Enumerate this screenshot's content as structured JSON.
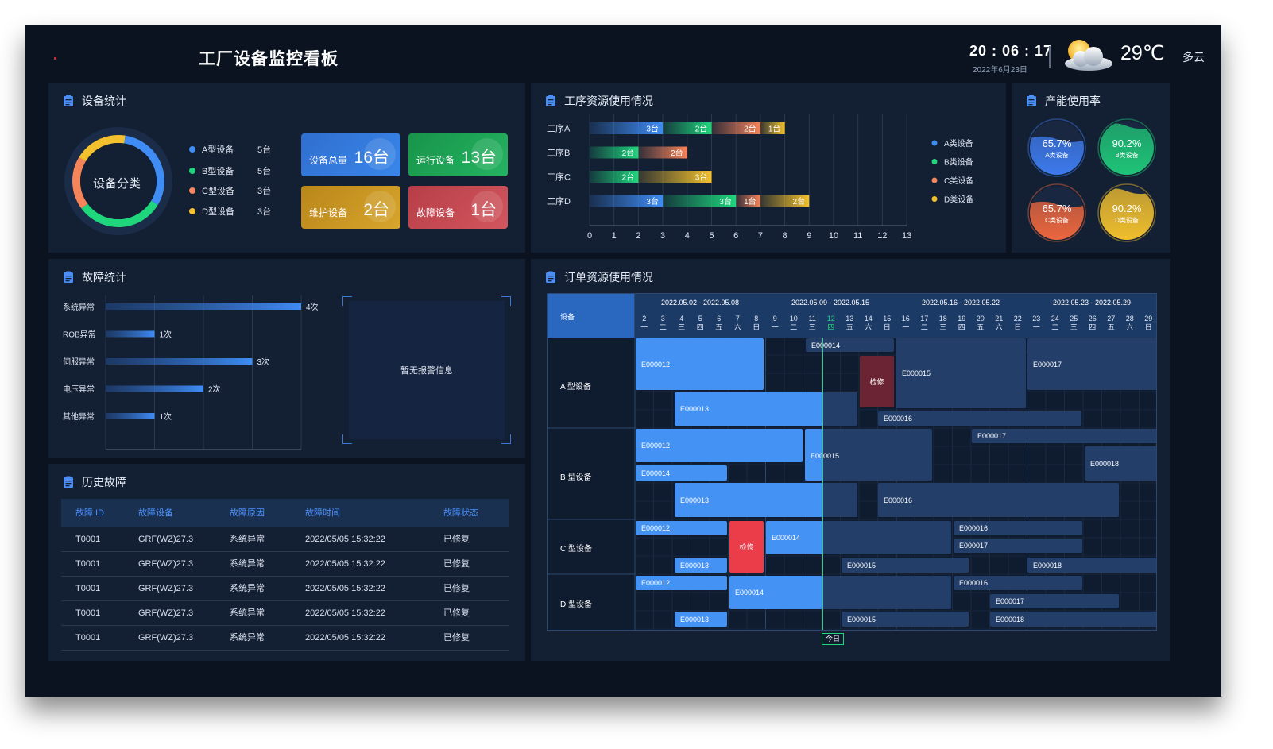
{
  "header": {
    "title": "工厂设备监控看板",
    "time": "20 : 06 : 17",
    "date": "2022年6月23日",
    "temperature": "29℃",
    "weather": "多云",
    "weather_icon": "partly-cloudy-icon"
  },
  "device_stats": {
    "title": "设备统计",
    "donut_label": "设备分类",
    "legend": [
      {
        "name": "A型设备",
        "count": "5台",
        "color": "#3e8cf4"
      },
      {
        "name": "B型设备",
        "count": "5台",
        "color": "#1fd67c"
      },
      {
        "name": "C型设备",
        "count": "3台",
        "color": "#f5845a"
      },
      {
        "name": "D型设备",
        "count": "3台",
        "color": "#f3c12d"
      }
    ],
    "cards": [
      {
        "label": "设备总量",
        "value": "16台",
        "color": "#3477d6"
      },
      {
        "label": "运行设备",
        "value": "13台",
        "color": "#1fa255"
      },
      {
        "label": "维护设备",
        "value": "2台",
        "color": "#c9961f"
      },
      {
        "label": "故障设备",
        "value": "1台",
        "color": "#c8474f"
      }
    ]
  },
  "process_resource": {
    "title": "工序资源使用情况",
    "type": "bar",
    "categories": [
      "工序A",
      "工序B",
      "工序C",
      "工序D"
    ],
    "x_ticks": [
      "0",
      "1",
      "2",
      "3",
      "4",
      "5",
      "6",
      "7",
      "8",
      "9",
      "10",
      "11",
      "12",
      "13"
    ],
    "xlim": [
      0,
      13
    ],
    "series": [
      {
        "name": "A类设备",
        "color": "#3e8cf4",
        "values": [
          3,
          0,
          0,
          3
        ],
        "labels": [
          "3台",
          "",
          "",
          "3台"
        ]
      },
      {
        "name": "B类设备",
        "color": "#1fd67c",
        "values": [
          2,
          2,
          2,
          3
        ],
        "labels": [
          "2台",
          "2台",
          "2台",
          "3台"
        ]
      },
      {
        "name": "C类设备",
        "color": "#f5845a",
        "values": [
          2,
          2,
          0,
          1
        ],
        "labels": [
          "2台",
          "2台",
          "",
          "1台"
        ]
      },
      {
        "name": "D类设备",
        "color": "#f3c12d",
        "values": [
          1,
          0,
          3,
          2
        ],
        "labels": [
          "1台",
          "",
          "3台",
          "2台"
        ]
      }
    ]
  },
  "capacity": {
    "title": "产能使用率",
    "items": [
      {
        "value": "65.7%",
        "label": "A类设备",
        "fraction": 0.657,
        "color": "#3e7cf0"
      },
      {
        "value": "90.2%",
        "label": "B类设备",
        "fraction": 0.902,
        "color": "#1fc678"
      },
      {
        "value": "65.7%",
        "label": "C类设备",
        "fraction": 0.657,
        "color": "#f0683e"
      },
      {
        "value": "90.2%",
        "label": "D类设备",
        "fraction": 0.902,
        "color": "#f3c12d"
      }
    ]
  },
  "fault_stats": {
    "title": "故障统计",
    "type": "bar",
    "categories": [
      "系统异常",
      "ROB异常",
      "伺服异常",
      "电压异常",
      "其他异常"
    ],
    "values": [
      4,
      1,
      3,
      2,
      1
    ],
    "value_labels": [
      "4次",
      "1次",
      "3次",
      "2次",
      "1次"
    ],
    "x_ticks": [
      "0",
      "1",
      "2",
      "3",
      "4"
    ],
    "xlim": [
      0,
      4
    ],
    "alarm_text": "暂无报警信息"
  },
  "history": {
    "title": "历史故障",
    "columns": [
      "故障 ID",
      "故障设备",
      "故障原因",
      "故障时间",
      "故障状态"
    ],
    "rows": [
      [
        "T0001",
        "GRF(WZ)27.3",
        "系统异常",
        "2022/05/05 15:32:22",
        "已修复"
      ],
      [
        "T0001",
        "GRF(WZ)27.3",
        "系统异常",
        "2022/05/05 15:32:22",
        "已修复"
      ],
      [
        "T0001",
        "GRF(WZ)27.3",
        "系统异常",
        "2022/05/05 15:32:22",
        "已修复"
      ],
      [
        "T0001",
        "GRF(WZ)27.3",
        "系统异常",
        "2022/05/05 15:32:22",
        "已修复"
      ],
      [
        "T0001",
        "GRF(WZ)27.3",
        "系统异常",
        "2022/05/05 15:32:22",
        "已修复"
      ]
    ]
  },
  "orders": {
    "title": "订单资源使用情况",
    "device_header": "设备",
    "weeks": [
      "2022.05.02 - 2022.05.08",
      "2022.05.09 - 2022.05.15",
      "2022.05.16 - 2022.05.22",
      "2022.05.23 - 2022.05.29"
    ],
    "days": [
      {
        "d": "2",
        "w": "一"
      },
      {
        "d": "3",
        "w": "二"
      },
      {
        "d": "4",
        "w": "三"
      },
      {
        "d": "5",
        "w": "四"
      },
      {
        "d": "6",
        "w": "五"
      },
      {
        "d": "7",
        "w": "六"
      },
      {
        "d": "8",
        "w": "日"
      },
      {
        "d": "9",
        "w": "一"
      },
      {
        "d": "10",
        "w": "二"
      },
      {
        "d": "11",
        "w": "三"
      },
      {
        "d": "12",
        "w": "四"
      },
      {
        "d": "13",
        "w": "五"
      },
      {
        "d": "14",
        "w": "六"
      },
      {
        "d": "15",
        "w": "日"
      },
      {
        "d": "16",
        "w": "一"
      },
      {
        "d": "17",
        "w": "二"
      },
      {
        "d": "18",
        "w": "三"
      },
      {
        "d": "19",
        "w": "四"
      },
      {
        "d": "20",
        "w": "五"
      },
      {
        "d": "21",
        "w": "六"
      },
      {
        "d": "22",
        "w": "日"
      },
      {
        "d": "23",
        "w": "一"
      },
      {
        "d": "24",
        "w": "二"
      },
      {
        "d": "25",
        "w": "三"
      },
      {
        "d": "26",
        "w": "四"
      },
      {
        "d": "27",
        "w": "五"
      },
      {
        "d": "28",
        "w": "六"
      },
      {
        "d": "29",
        "w": "日"
      }
    ],
    "today_label": "今日",
    "devices": [
      "A 型设备",
      "B 型设备",
      "C 型设备",
      "D 型设备"
    ]
  }
}
